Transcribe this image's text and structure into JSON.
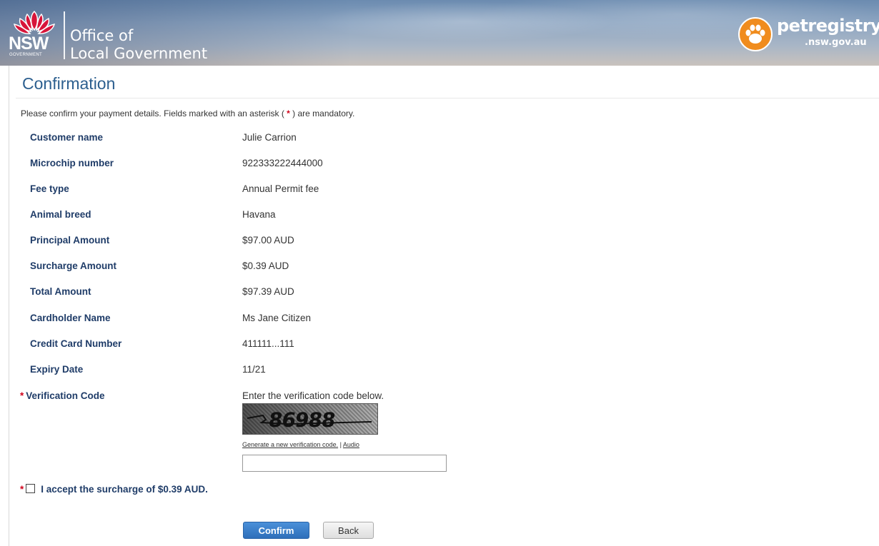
{
  "header": {
    "nsw_wordmark": "NSW",
    "nsw_government": "GOVERNMENT",
    "office_line1": "Office of",
    "office_line2": "Local Government",
    "petregistry_name": "petregistry",
    "petregistry_domain": ".nsw.gov.au"
  },
  "page": {
    "title": "Confirmation",
    "intro_before": "Please confirm your payment details. Fields marked with an asterisk ( ",
    "intro_star": "*",
    "intro_after": " ) are mandatory."
  },
  "details": [
    {
      "label": "Customer name",
      "value": "Julie Carrion"
    },
    {
      "label": "Microchip number",
      "value": "922333222444000"
    },
    {
      "label": "Fee type",
      "value": "Annual Permit fee"
    },
    {
      "label": "Animal breed",
      "value": "Havana"
    },
    {
      "label": "Principal Amount",
      "value": "$97.00 AUD"
    },
    {
      "label": "Surcharge Amount",
      "value": "$0.39 AUD"
    },
    {
      "label": "Total Amount",
      "value": "$97.39 AUD"
    },
    {
      "label": "Cardholder Name",
      "value": "Ms Jane Citizen"
    },
    {
      "label": "Credit Card Number",
      "value": "411111...111"
    },
    {
      "label": "Expiry Date",
      "value": "11/21"
    }
  ],
  "verification": {
    "required_mark": "*",
    "label": "Verification Code",
    "hint": "Enter the verification code below.",
    "captcha_text": "86988",
    "regenerate_link": "Generate a new verification code.",
    "separator": " | ",
    "audio_link": "Audio",
    "input_value": ""
  },
  "surcharge": {
    "required_mark": "*",
    "label": "I accept the surcharge of $0.39 AUD.",
    "checked": false
  },
  "actions": {
    "confirm_label": "Confirm",
    "back_label": "Back"
  },
  "colors": {
    "label_blue": "#1f3c68",
    "title_blue": "#2c5f8f",
    "required_red": "#d0021b",
    "confirm_blue": "#3a7fcb",
    "petregistry_orange": "#f08c1e"
  }
}
